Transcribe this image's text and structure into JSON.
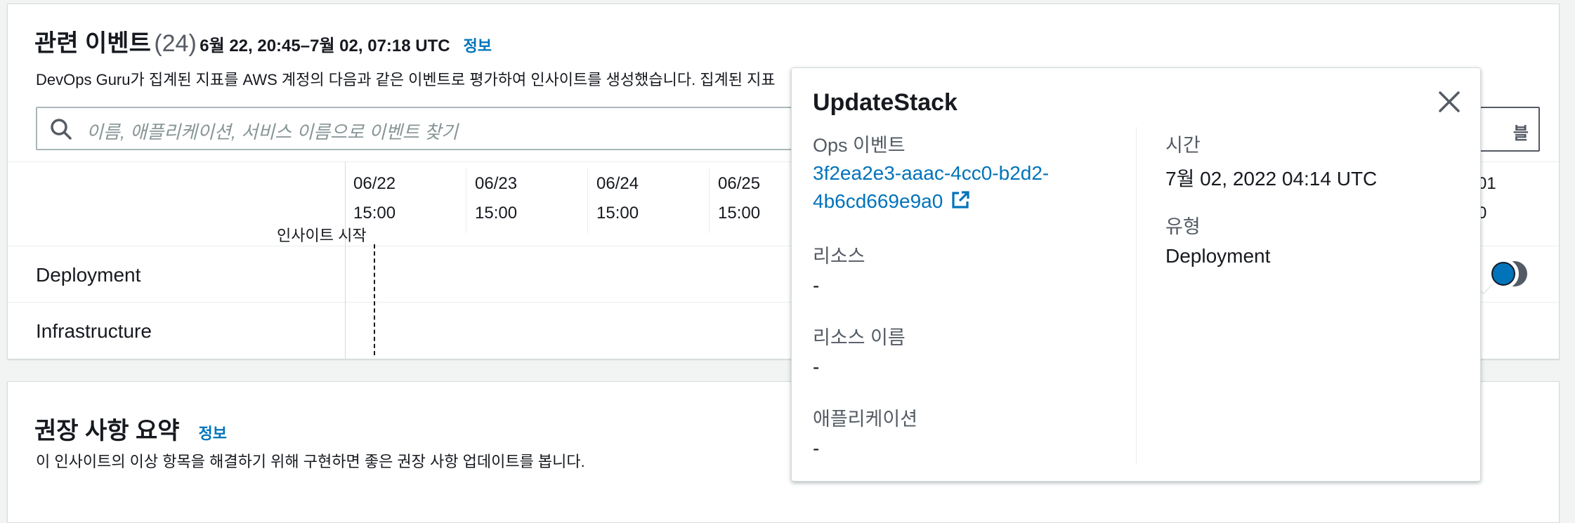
{
  "events_panel": {
    "title": "관련 이벤트",
    "count": "(24)",
    "range": "6월 22, 20:45–7월 02, 07:18 UTC",
    "info": "정보",
    "description": "DevOps Guru가 집계된 지표를 AWS 계정의 다음과 같은 이벤트로 평가하여 인사이트를 생성했습니다. 집계된 지표",
    "search_placeholder": "이름, 애플리케이션, 서비스 이름으로 이벤트 찾기",
    "button_partial": "블"
  },
  "timeline": {
    "ticks": [
      {
        "date": "06/22",
        "time": "15:00"
      },
      {
        "date": "06/23",
        "time": "15:00"
      },
      {
        "date": "06/24",
        "time": "15:00"
      },
      {
        "date": "06/25",
        "time": "15:00"
      }
    ],
    "last_tick_partial": {
      "date": "01",
      "time": "0"
    },
    "insight_start": "인사이트 시작",
    "rows": [
      "Deployment",
      "Infrastructure"
    ]
  },
  "popover": {
    "title": "UpdateStack",
    "ops_event_label": "Ops 이벤트",
    "ops_event_line1": "3f2ea2e3-aaac-4cc0-b2d2-",
    "ops_event_line2": "4b6cd669e9a0",
    "resource_label": "리소스",
    "resource_value": "-",
    "resource_name_label": "리소스 이름",
    "resource_name_value": "-",
    "application_label": "애플리케이션",
    "application_value": "-",
    "time_label": "시간",
    "time_value": "7월 02, 2022 04:14 UTC",
    "type_label": "유형",
    "type_value": "Deployment"
  },
  "recommendations_panel": {
    "title": "권장 사항 요약",
    "info": "정보",
    "description": "이 인사이트의 이상 항목을 해결하기 위해 구현하면 좋은 권장 사항 업데이트를 봅니다."
  },
  "colors": {
    "link": "#0073bb",
    "marker": "#0073bb",
    "text": "#16191f",
    "secondary_text": "#545b64"
  }
}
